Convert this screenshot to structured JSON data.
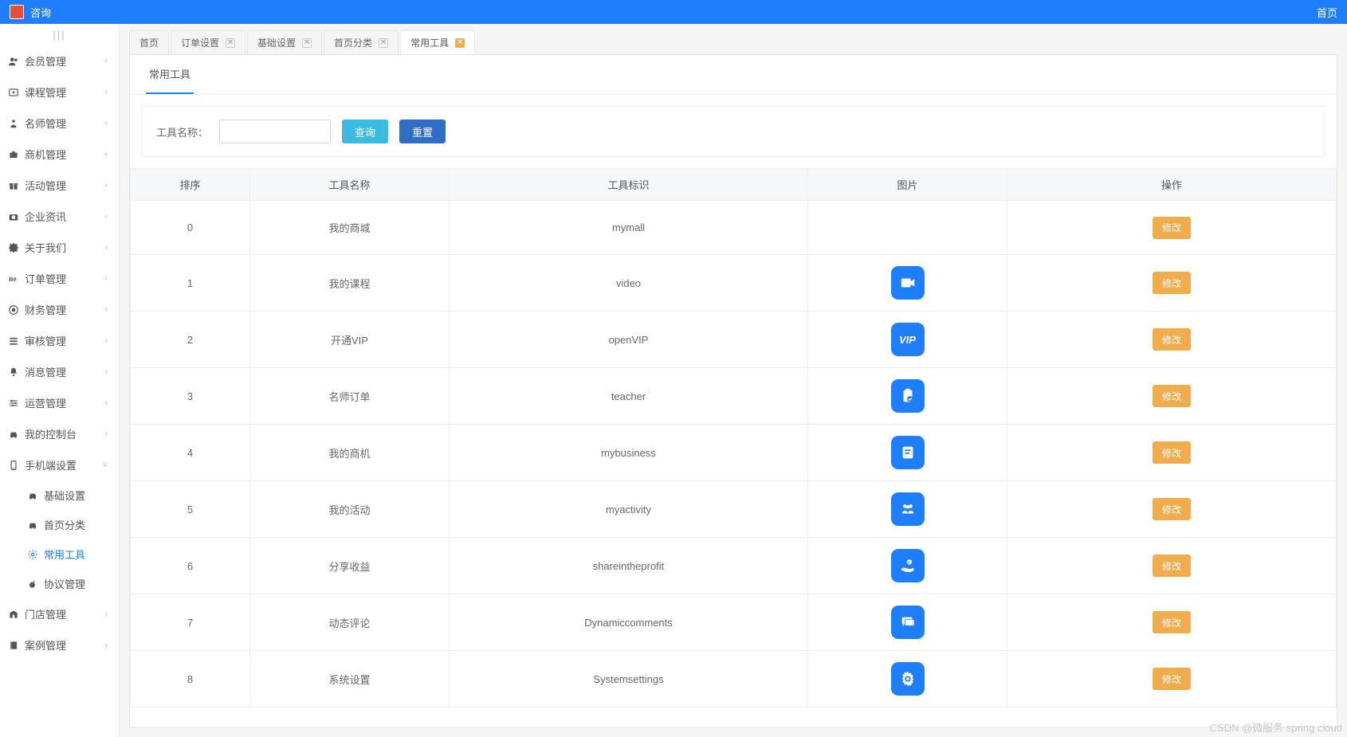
{
  "topbar": {
    "title": "咨询",
    "right_link": "首页"
  },
  "sidebar": {
    "items": [
      {
        "label": "会员管理",
        "icon": "users"
      },
      {
        "label": "课程管理",
        "icon": "play"
      },
      {
        "label": "名师管理",
        "icon": "person"
      },
      {
        "label": "商机管理",
        "icon": "briefcase"
      },
      {
        "label": "活动管理",
        "icon": "gift"
      },
      {
        "label": "企业资讯",
        "icon": "camera"
      },
      {
        "label": "关于我们",
        "icon": "puzzle"
      },
      {
        "label": "订单管理",
        "icon": "be"
      },
      {
        "label": "财务管理",
        "icon": "coin"
      },
      {
        "label": "审核管理",
        "icon": "list"
      },
      {
        "label": "消息管理",
        "icon": "bell"
      },
      {
        "label": "运营管理",
        "icon": "sliders"
      },
      {
        "label": "我的控制台",
        "icon": "car"
      },
      {
        "label": "手机端设置",
        "icon": "phone",
        "expanded": true,
        "children": [
          {
            "label": "基础设置",
            "icon": "car-sm"
          },
          {
            "label": "首页分类",
            "icon": "car-sm"
          },
          {
            "label": "常用工具",
            "icon": "gear-sm",
            "active": true
          },
          {
            "label": "协议管理",
            "icon": "bomb"
          }
        ]
      },
      {
        "label": "门店管理",
        "icon": "building"
      },
      {
        "label": "案例管理",
        "icon": "book"
      }
    ]
  },
  "tabs": [
    {
      "label": "首页",
      "closable": false,
      "active": false
    },
    {
      "label": "订单设置",
      "closable": true,
      "active": false
    },
    {
      "label": "基础设置",
      "closable": true,
      "active": false
    },
    {
      "label": "首页分类",
      "closable": true,
      "active": false
    },
    {
      "label": "常用工具",
      "closable": true,
      "active": true
    }
  ],
  "page": {
    "inner_tab": "常用工具",
    "filter_label": "工具名称：",
    "search_btn": "查询",
    "reset_btn": "重置"
  },
  "table": {
    "headers": [
      "排序",
      "工具名称",
      "工具标识",
      "图片",
      "操作"
    ],
    "action_label": "修改",
    "rows": [
      {
        "sort": "0",
        "name": "我的商城",
        "ident": "mymall",
        "icon": ""
      },
      {
        "sort": "1",
        "name": "我的课程",
        "ident": "video",
        "icon": "video"
      },
      {
        "sort": "2",
        "name": "开通VIP",
        "ident": "openVIP",
        "icon": "vip"
      },
      {
        "sort": "3",
        "name": "名师订单",
        "ident": "teacher",
        "icon": "clipboard"
      },
      {
        "sort": "4",
        "name": "我的商机",
        "ident": "mybusiness",
        "icon": "note"
      },
      {
        "sort": "5",
        "name": "我的活动",
        "ident": "myactivity",
        "icon": "group"
      },
      {
        "sort": "6",
        "name": "分享收益",
        "ident": "shareintheprofit",
        "icon": "hand"
      },
      {
        "sort": "7",
        "name": "动态评论",
        "ident": "Dynamiccomments",
        "icon": "chat"
      },
      {
        "sort": "8",
        "name": "系统设置",
        "ident": "Systemsettings",
        "icon": "gear"
      }
    ]
  },
  "watermark": "CSDN @微服务 spring cloud"
}
